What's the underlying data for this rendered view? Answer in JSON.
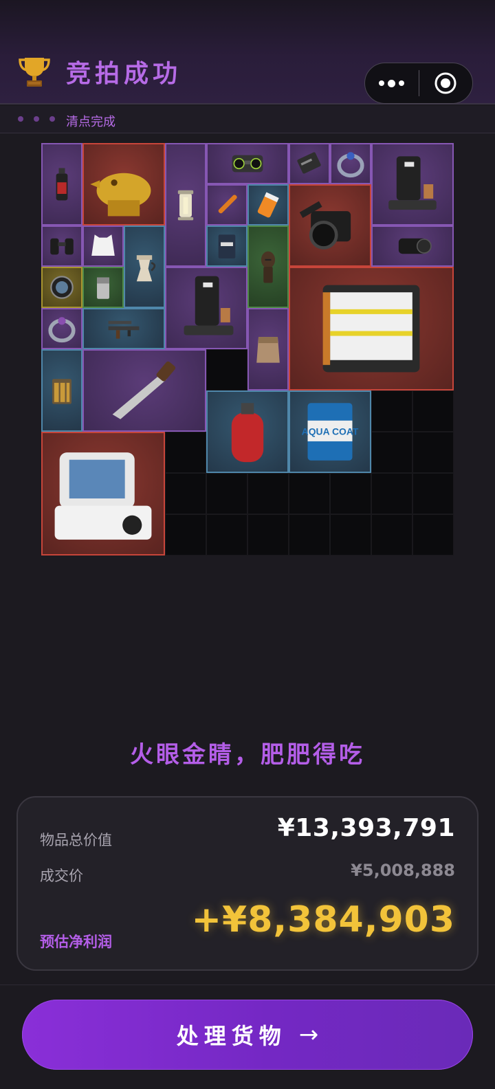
{
  "header": {
    "title": "竞拍成功",
    "trophy_icon": "trophy-icon",
    "accent_color": "#b66be6"
  },
  "status_bar": {
    "status_text": "清点完成"
  },
  "inventory": {
    "items": [
      {
        "name": "spray-bottle",
        "rarity": "purple"
      },
      {
        "name": "golden-crocodile-statue",
        "rarity": "red"
      },
      {
        "name": "lantern",
        "rarity": "purple"
      },
      {
        "name": "boombox",
        "rarity": "purple"
      },
      {
        "name": "card-reader",
        "rarity": "purple"
      },
      {
        "name": "ring",
        "rarity": "purple"
      },
      {
        "name": "coffee-machine",
        "rarity": "purple"
      },
      {
        "name": "pen",
        "rarity": "purple"
      },
      {
        "name": "pill-bottle",
        "rarity": "blue"
      },
      {
        "name": "film-camera",
        "rarity": "red"
      },
      {
        "name": "camera-lens",
        "rarity": "purple"
      },
      {
        "name": "binoculars",
        "rarity": "purple"
      },
      {
        "name": "vest",
        "rarity": "purple"
      },
      {
        "name": "moka-pot",
        "rarity": "blue"
      },
      {
        "name": "coffee-bag",
        "rarity": "blue"
      },
      {
        "name": "tribal-statue",
        "rarity": "green"
      },
      {
        "name": "magnifier-lens",
        "rarity": "gold"
      },
      {
        "name": "lighter",
        "rarity": "green"
      },
      {
        "name": "coffee-machine-2",
        "rarity": "purple"
      },
      {
        "name": "battery-pack",
        "rarity": "red"
      },
      {
        "name": "ring-2",
        "rarity": "purple"
      },
      {
        "name": "assault-rifle",
        "rarity": "blue"
      },
      {
        "name": "cloth-pouch",
        "rarity": "purple"
      },
      {
        "name": "ammo-box",
        "rarity": "blue"
      },
      {
        "name": "hunting-knife",
        "rarity": "purple"
      },
      {
        "name": "gas-cylinder",
        "rarity": "blue"
      },
      {
        "name": "paint-can",
        "rarity": "blue",
        "text": "AQUA COAT"
      },
      {
        "name": "medical-monitor",
        "rarity": "red"
      }
    ]
  },
  "slogan": "火眼金睛，肥肥得吃",
  "summary": {
    "total_label": "物品总价值",
    "total_value": "¥13,393,791",
    "deal_label": "成交价",
    "deal_value": "¥5,008,888",
    "profit_label": "预估净利润",
    "profit_value": "+¥8,384,903",
    "profit_color": "#f2c33a"
  },
  "action": {
    "label": "处理货物",
    "arrow": "→"
  }
}
